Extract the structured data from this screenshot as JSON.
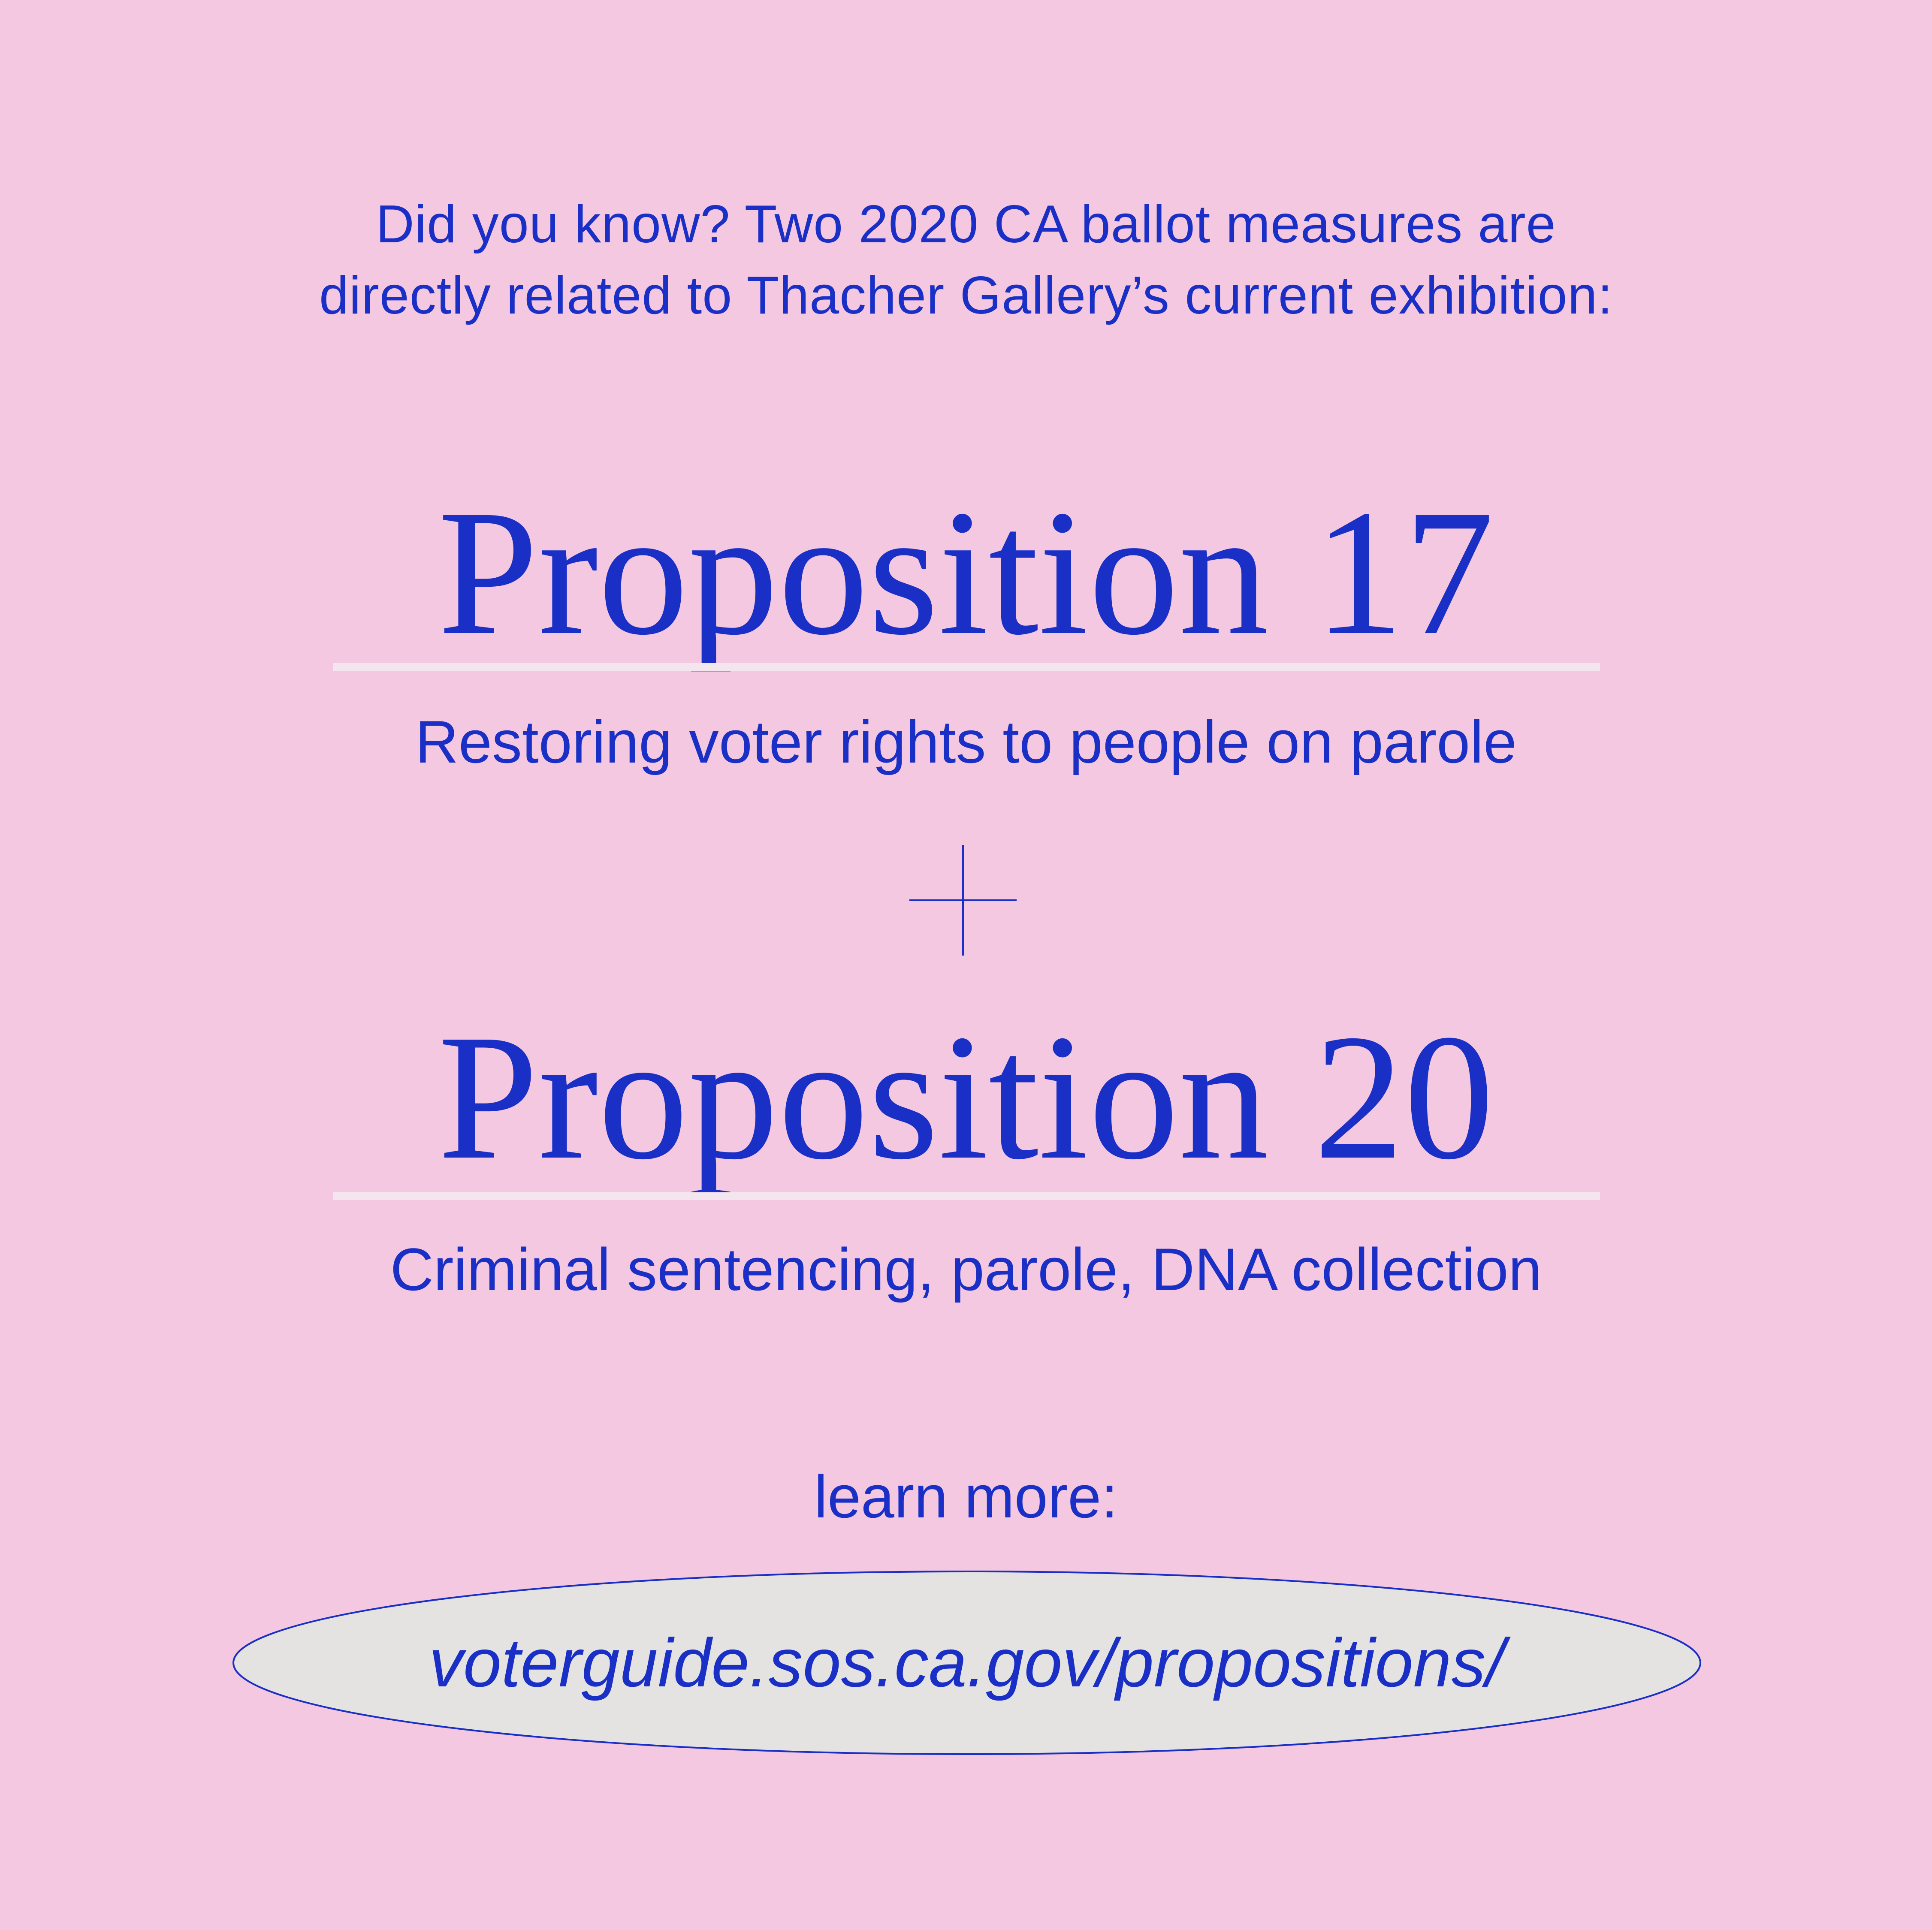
{
  "intro": {
    "line1": "Did you know? Two 2020 CA ballot measures are",
    "line2": "directly related to Thacher Gallery’s current exhibition:"
  },
  "propositions": [
    {
      "title": "Proposition 17",
      "subtitle": "Restoring voter rights to people on parole"
    },
    {
      "title": "Proposition 20",
      "subtitle": "Criminal sentencing, parole, DNA collection"
    }
  ],
  "connector_icon": "plus-icon",
  "learn_more": {
    "label": "learn more:",
    "link": "voterguide.sos.ca.gov/propositions/"
  },
  "colors": {
    "background": "#f3c8e0",
    "text": "#1a2fc6",
    "rule": "#f3e6ee",
    "oval_fill": "#e4e3e1"
  }
}
